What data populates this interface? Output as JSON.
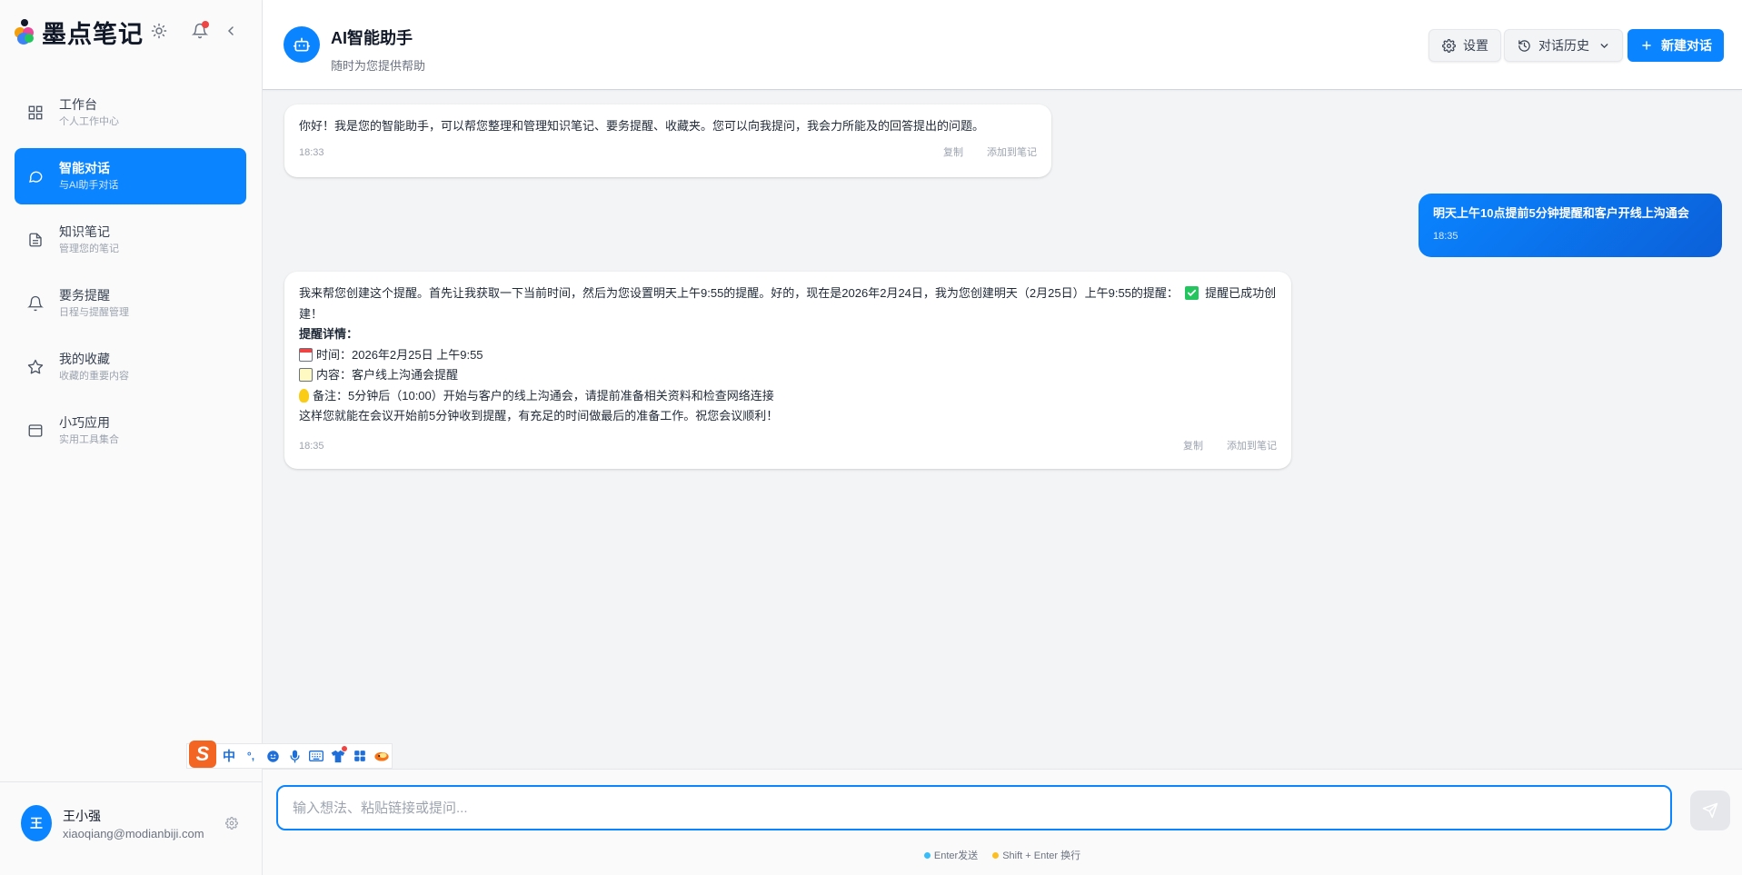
{
  "brand": {
    "name": "墨点笔记"
  },
  "sidebar": {
    "items": [
      {
        "title": "工作台",
        "sub": "个人工作中心",
        "icon": "dashboard-icon"
      },
      {
        "title": "智能对话",
        "sub": "与AI助手对话",
        "icon": "chat-bubble-icon"
      },
      {
        "title": "知识笔记",
        "sub": "管理您的笔记",
        "icon": "document-icon"
      },
      {
        "title": "要务提醒",
        "sub": "日程与提醒管理",
        "icon": "bell-icon"
      },
      {
        "title": "我的收藏",
        "sub": "收藏的重要内容",
        "icon": "star-icon"
      },
      {
        "title": "小巧应用",
        "sub": "实用工具集合",
        "icon": "app-window-icon"
      }
    ],
    "active_index": 1
  },
  "user": {
    "initial": "王",
    "name": "王小强",
    "email": "xiaoqiang@modianbiji.com"
  },
  "ime": {
    "lang": "中",
    "punct": "°,"
  },
  "header": {
    "title": "AI智能助手",
    "subtitle": "随时为您提供帮助",
    "settings_label": "设置",
    "history_label": "对话历史",
    "new_chat_label": "新建对话"
  },
  "messages": {
    "m1": {
      "text": "你好！我是您的智能助手，可以帮您整理和管理知识笔记、要务提醒、收藏夹。您可以向我提问，我会力所能及的回答提出的问题。",
      "time": "18:33",
      "copy": "复制",
      "add": "添加到笔记"
    },
    "m2": {
      "text": "明天上午10点提前5分钟提醒和客户开线上沟通会",
      "time": "18:35"
    },
    "m3": {
      "line1": "我来帮您创建这个提醒。首先让我获取一下当前时间，然后为您设置明天上午9:55的提醒。好的，现在是2026年2月24日，我为您创建明天（2月25日）上午9:55的提醒：",
      "line1b": "提醒已成功创建！",
      "details_title": "提醒详情：",
      "time_line": "时间：2026年2月25日 上午9:55",
      "content_line": "内容：客户线上沟通会提醒",
      "note_line": "备注：5分钟后（10:00）开始与客户的线上沟通会，请提前准备相关资料和检查网络连接",
      "closing": "这样您就能在会议开始前5分钟收到提醒，有充足的时间做最后的准备工作。祝您会议顺利！",
      "time": "18:35",
      "copy": "复制",
      "add": "添加到笔记"
    }
  },
  "input": {
    "placeholder": "输入想法、粘贴链接或提问...",
    "value": "",
    "hint_send": "Enter发送",
    "hint_newline": "Shift + Enter 换行"
  },
  "colors": {
    "accent": "#0a84ff",
    "hint_blue": "#38bdf8",
    "hint_yellow": "#fbbf24"
  }
}
